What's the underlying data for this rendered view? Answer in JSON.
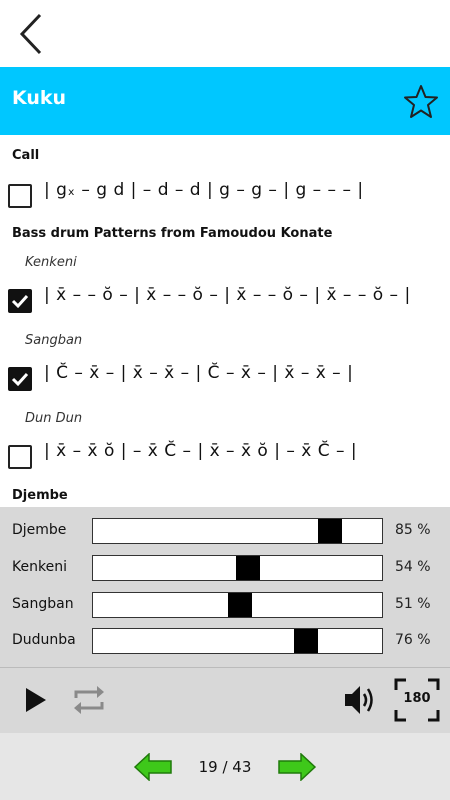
{
  "header": {
    "back_icon": "chevron-left-icon"
  },
  "titlebar": {
    "title": "Kuku",
    "favorite_icon": "star-outline-icon",
    "color": "#00c7ff"
  },
  "sections": [
    {
      "title": "Call",
      "rows": [
        {
          "label": "",
          "checked": false,
          "pattern": "| gₓ – g d | – d – d | g – g – | g – – – |"
        }
      ]
    },
    {
      "title": "Bass drum Patterns from Famoudou Konate",
      "rows": [
        {
          "label": "Kenkeni",
          "checked": true,
          "pattern": "| x̄ – – ŏ – | x̄ – – ŏ – | x̄ – – ŏ – | x̄ – – ŏ – |"
        },
        {
          "label": "Sangban",
          "checked": true,
          "pattern": "| C̆ – x̄ – | x̄ – x̄ – | C̆ – x̄ – | x̄ – x̄ – |"
        },
        {
          "label": "Dun Dun",
          "checked": false,
          "pattern": "| x̄ – x̄ ŏ | – x̄ C̆ – | x̄ – x̄ ŏ | – x̄ C̆ – |"
        }
      ]
    },
    {
      "title": "Djembe",
      "rows": []
    }
  ],
  "mixer": [
    {
      "name": "Djembe",
      "value": 85,
      "value_label": "85 %"
    },
    {
      "name": "Kenkeni",
      "value": 54,
      "value_label": "54 %"
    },
    {
      "name": "Sangban",
      "value": 51,
      "value_label": "51 %"
    },
    {
      "name": "Dudunba",
      "value": 76,
      "value_label": "76 %"
    }
  ],
  "controls": {
    "play_icon": "play-icon",
    "repeat_icon": "repeat-icon",
    "volume_icon": "volume-icon",
    "rotate_label": "180"
  },
  "footer": {
    "page": "19 / 43",
    "prev_icon": "arrow-left-icon",
    "next_icon": "arrow-right-icon",
    "arrow_color": "#3ec81a"
  }
}
